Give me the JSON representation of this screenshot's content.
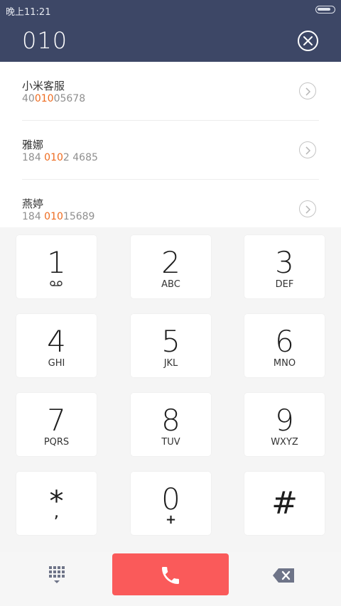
{
  "status_bar": {
    "time": "晚上11:21",
    "battery_level": 0.85
  },
  "dialer": {
    "input": "010"
  },
  "contacts": [
    {
      "name": "小米客服",
      "number_pre": "40",
      "number_match": "010",
      "number_post": "05678"
    },
    {
      "name": "雅娜",
      "number_pre": "184 ",
      "number_match": "010",
      "number_post": "2 4685"
    },
    {
      "name": "燕婷",
      "number_pre": "184 ",
      "number_match": "010",
      "number_post": "15689"
    }
  ],
  "keys": [
    {
      "digit": "1",
      "letters": ""
    },
    {
      "digit": "2",
      "letters": "ABC"
    },
    {
      "digit": "3",
      "letters": "DEF"
    },
    {
      "digit": "4",
      "letters": "GHI"
    },
    {
      "digit": "5",
      "letters": "JKL"
    },
    {
      "digit": "6",
      "letters": "MNO"
    },
    {
      "digit": "7",
      "letters": "PQRS"
    },
    {
      "digit": "8",
      "letters": "TUV"
    },
    {
      "digit": "9",
      "letters": "WXYZ"
    },
    {
      "digit": "*",
      "letters": ","
    },
    {
      "digit": "0",
      "letters": "+"
    },
    {
      "digit": "#",
      "letters": ""
    }
  ],
  "icons": {
    "key_1": "voicemail-icon",
    "clear": "close-icon",
    "detail": "chevron-right-icon",
    "dialpad": "dialpad-icon",
    "call": "phone-icon",
    "backspace": "backspace-icon"
  },
  "colors": {
    "header": "#3d4766",
    "highlight": "#ee6b1f",
    "call_button": "#fa5a5a",
    "icon_gray": "#6e7488"
  }
}
